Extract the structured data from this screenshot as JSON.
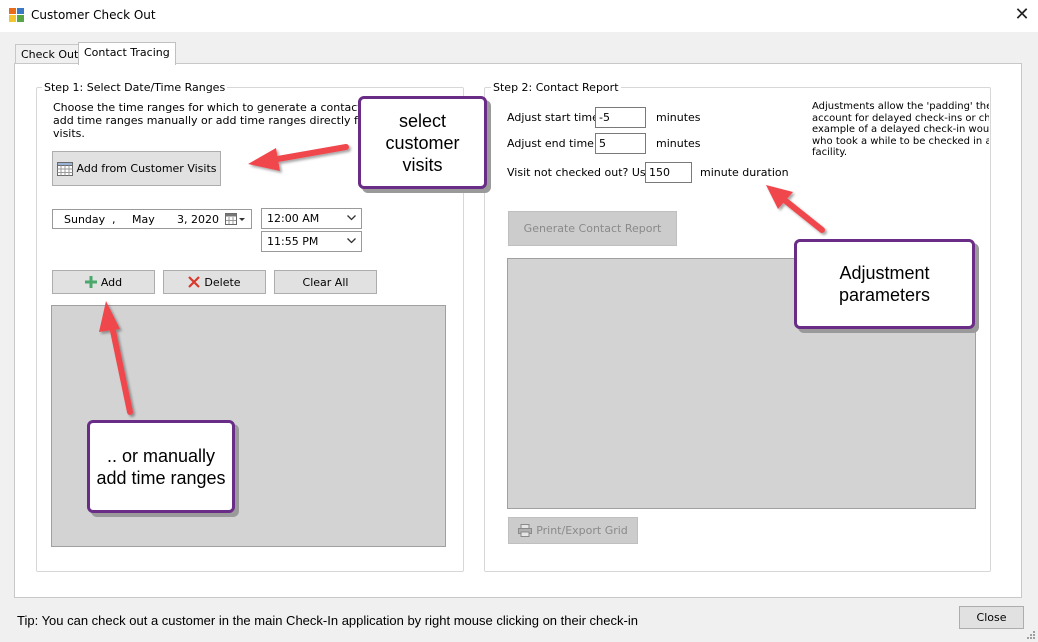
{
  "window": {
    "title": "Customer Check Out",
    "close_glyph": "✕"
  },
  "tabs": [
    {
      "label": "Check Out",
      "active": false
    },
    {
      "label": "Contact Tracing",
      "active": true
    }
  ],
  "step1": {
    "legend": "Step 1: Select Date/Time Ranges",
    "instructions": [
      "Choose the time ranges for which to generate a contact report.  Y",
      "add time ranges manually or add time ranges directly from a selec",
      "visits."
    ],
    "add_from_visits_label": "Add from Customer Visits",
    "date_picker": {
      "weekday": "Sunday",
      "sep": ",",
      "month": "May",
      "day_year": "3, 2020"
    },
    "start_time": "12:00 AM",
    "end_time": "11:55 PM",
    "add_label": "Add",
    "delete_label": "Delete",
    "clear_all_label": "Clear All"
  },
  "step2": {
    "legend": "Step 2: Contact Report",
    "adjust_start_label": "Adjust start time",
    "adjust_start_value": "-5",
    "adjust_start_unit": "minutes",
    "adjust_end_label": "Adjust end time",
    "adjust_end_value": "5",
    "adjust_end_unit": "minutes",
    "not_checked_out_label": "Visit not checked out? Use",
    "not_checked_out_value": "150",
    "not_checked_out_unit": "minute duration",
    "help_lines": [
      "Adjustments allow the 'padding' the tim",
      "account for delayed check-ins or chec",
      "example of a delayed check-in would l",
      "who took a while to be checked in afte",
      "facility."
    ],
    "generate_label": "Generate Contact Report",
    "print_label": "Print/Export Grid"
  },
  "callouts": {
    "select_visits": "select\ncustomer\nvisits",
    "adjustment": "Adjustment\nparameters",
    "manual": ".. or manually\nadd time ranges"
  },
  "footer": {
    "tip": "Tip:  You can check out a customer in the main Check-In application by right mouse clicking on their check-in",
    "close_label": "Close"
  },
  "colors": {
    "callout_border": "#6a2d87",
    "arrow": "#f0474d",
    "add_icon": "#4aa86a",
    "delete_icon": "#d9382a"
  }
}
